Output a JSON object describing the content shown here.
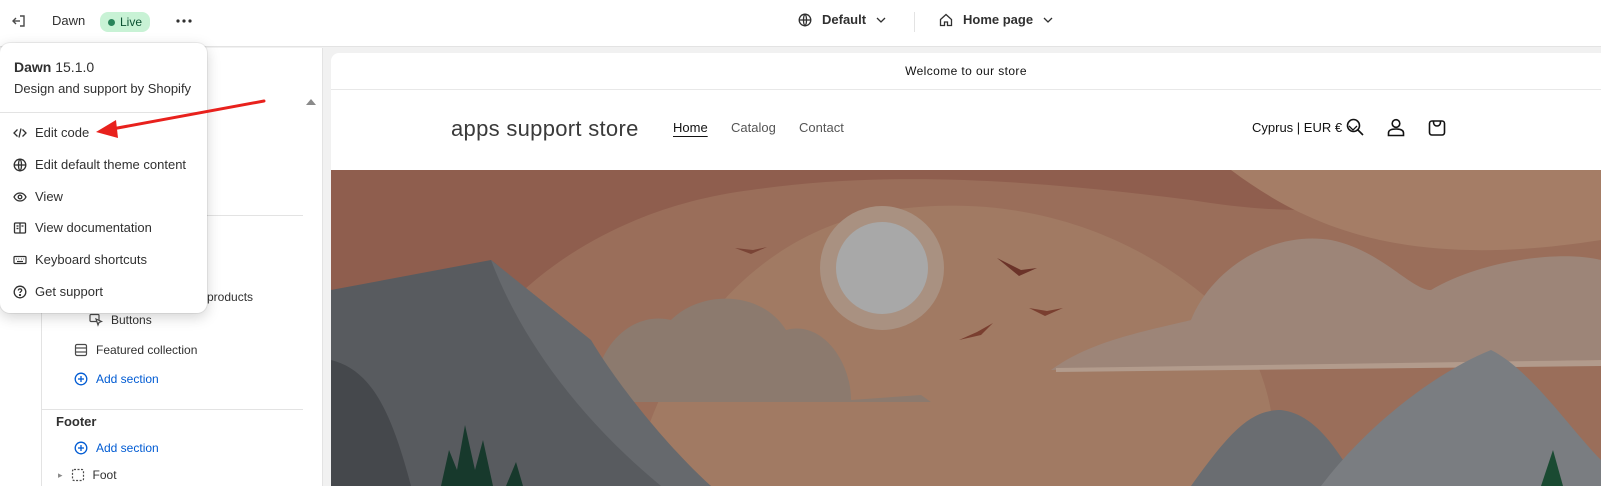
{
  "topbar": {
    "theme_name": "Dawn",
    "status_badge": "Live",
    "template_selector": "Default",
    "page_selector": "Home page"
  },
  "popover": {
    "theme_name": "Dawn",
    "theme_version": "15.1.0",
    "subtitle": "Design and support by Shopify",
    "items": [
      {
        "label": "Edit code",
        "icon": "code-icon"
      },
      {
        "label": "Edit default theme content",
        "icon": "globe-icon"
      },
      {
        "label": "View",
        "icon": "eye-icon"
      },
      {
        "label": "View documentation",
        "icon": "book-icon"
      },
      {
        "label": "Keyboard shortcuts",
        "icon": "keyboard-icon"
      },
      {
        "label": "Get support",
        "icon": "question-icon"
      }
    ]
  },
  "sidebar": {
    "partial_item": "products",
    "buttons_block": "Buttons",
    "featured_collection": "Featured collection",
    "add_section_template": "Add section",
    "footer_heading": "Footer",
    "add_section_footer": "Add section",
    "footer_item_partial": "Foot"
  },
  "preview": {
    "announcement": "Welcome to our store",
    "store_name": "apps support store",
    "nav": [
      "Home",
      "Catalog",
      "Contact"
    ],
    "currency": "Cyprus | EUR €"
  },
  "colors": {
    "annotation_arrow": "#e8211d",
    "live_badge_bg": "#c8f2d5",
    "link_blue": "#005bd3"
  }
}
